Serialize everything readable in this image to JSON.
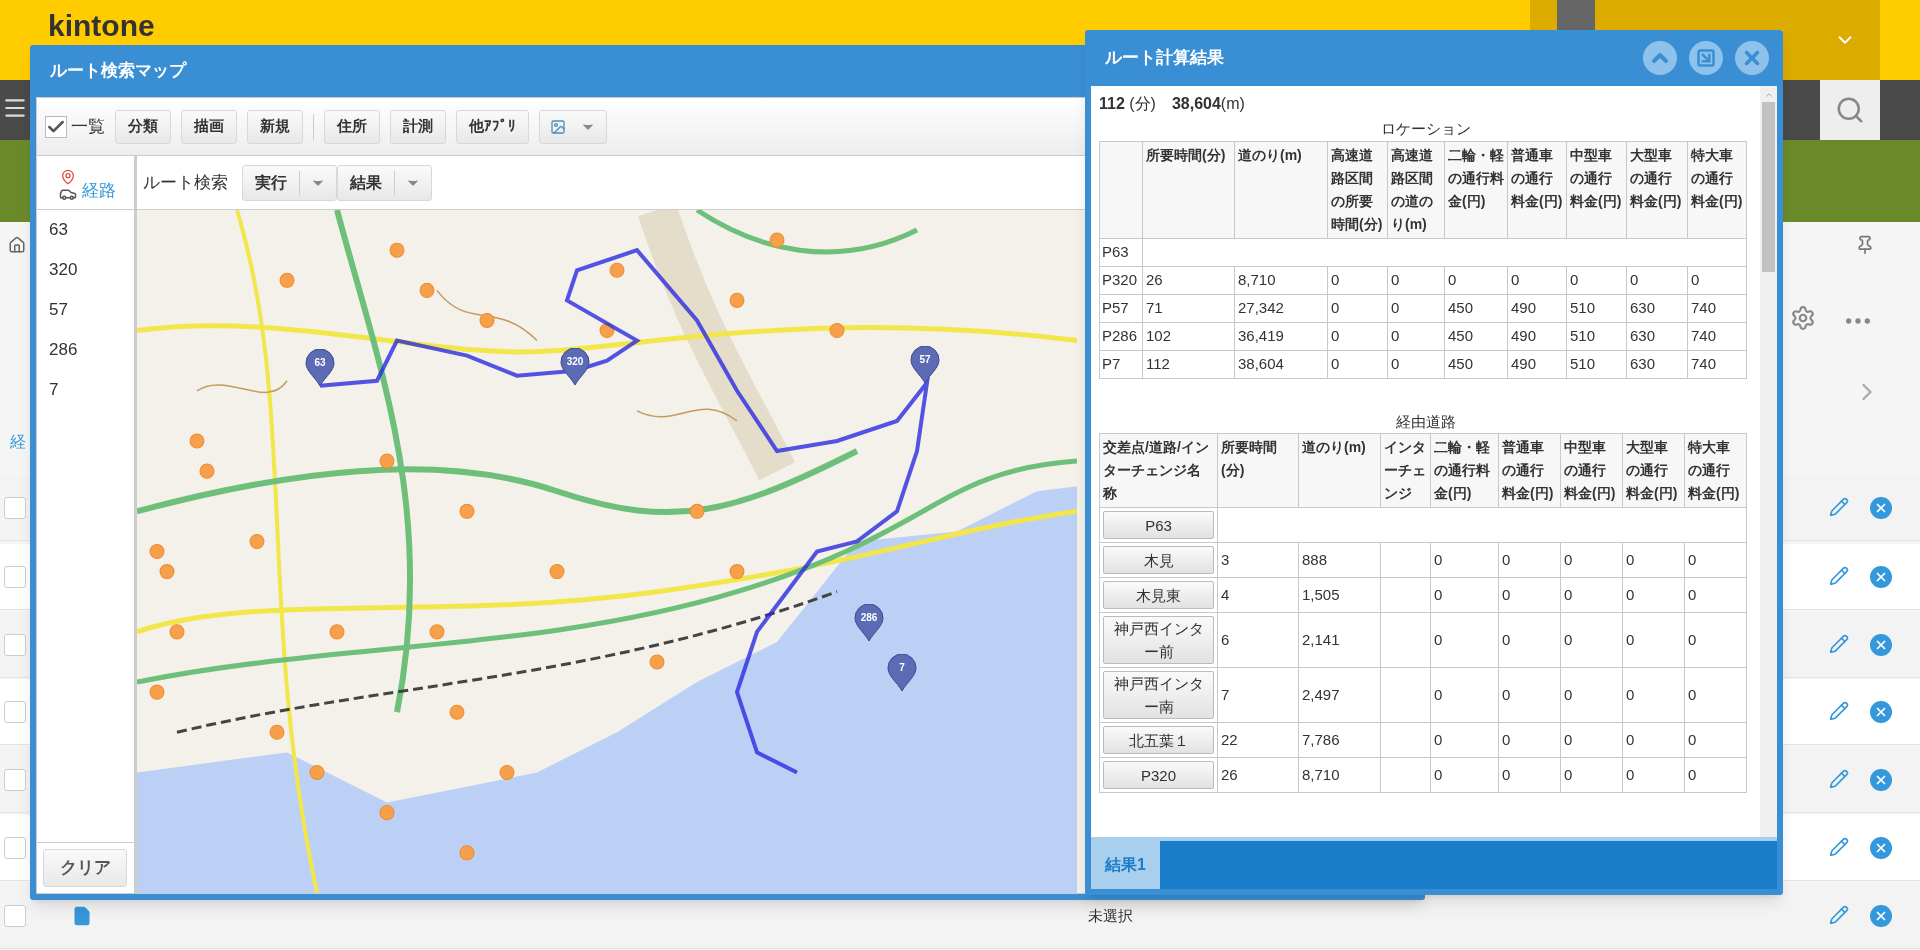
{
  "app": {
    "logo": "kintone",
    "column_label": "経"
  },
  "records": [
    {
      "checked": false
    },
    {
      "checked": false
    },
    {
      "checked": false
    },
    {
      "checked": false
    },
    {
      "checked": false
    },
    {
      "checked": false
    },
    {
      "checked": false,
      "status": "未選択"
    }
  ],
  "map_window": {
    "title": "ルート検索マップ",
    "list_toggle": {
      "label": "一覧",
      "checked": true
    },
    "toolbar_groups": [
      [
        "分類",
        "描画",
        "新規"
      ],
      [
        "住所",
        "計測",
        "他ｱﾌﾟﾘ"
      ]
    ],
    "side_tab": {
      "label": "経路",
      "selected": true
    },
    "route_search": {
      "label": "ルート検索",
      "buttons": [
        "実行",
        "結果"
      ]
    },
    "route_points": [
      "63",
      "320",
      "57",
      "286",
      "7"
    ],
    "clear_button": "クリア",
    "map": {
      "markers": [
        {
          "label": "63"
        },
        {
          "label": "320"
        },
        {
          "label": "57"
        },
        {
          "label": "286"
        },
        {
          "label": "7"
        }
      ]
    }
  },
  "result_window": {
    "title": "ルート計算結果",
    "summary": [
      "**112** (分)",
      "**38,604**(m)"
    ],
    "locations": {
      "caption": "ロケーション",
      "columns": [
        "所要時間(分)",
        "道のり(m)",
        "高速道路区間の所要時間(分)",
        "高速道路区間の道のり(m)",
        "二輪・軽の通行料金(円)",
        "普通車の通行料金(円)",
        "中型車の通行料金(円)",
        "大型車の通行料金(円)",
        "特大車の通行料金(円)"
      ],
      "rows": [
        {
          "point": "P63"
        },
        {
          "point": "P320",
          "time": "26",
          "distance": "8,710",
          "highway_time": "0",
          "highway_distance": "0",
          "tolls": [
            "0",
            "0",
            "0",
            "0",
            "0"
          ]
        },
        {
          "point": "P57",
          "time": "71",
          "distance": "27,342",
          "highway_time": "0",
          "highway_distance": "0",
          "tolls": [
            "450",
            "490",
            "510",
            "630",
            "740"
          ]
        },
        {
          "point": "P286",
          "time": "102",
          "distance": "36,419",
          "highway_time": "0",
          "highway_distance": "0",
          "tolls": [
            "450",
            "490",
            "510",
            "630",
            "740"
          ]
        },
        {
          "point": "P7",
          "time": "112",
          "distance": "38,604",
          "highway_time": "0",
          "highway_distance": "0",
          "tolls": [
            "450",
            "490",
            "510",
            "630",
            "740"
          ]
        }
      ]
    },
    "via_roads": {
      "caption": "経由道路",
      "columns": [
        "交差点/道路/インターチェンジ名称",
        "所要時間(分)",
        "道のり(m)",
        "インターチェンジ",
        "二輪・軽の通行料金(円)",
        "普通車の通行料金(円)",
        "中型車の通行料金(円)",
        "大型車の通行料金(円)",
        "特大車の通行料金(円)"
      ],
      "rows": [
        {
          "name": "P63"
        },
        {
          "name": "木見",
          "time": "3",
          "distance": "888",
          "tolls": [
            "0",
            "0",
            "0",
            "0",
            "0"
          ]
        },
        {
          "name": "木見東",
          "time": "4",
          "distance": "1,505",
          "tolls": [
            "0",
            "0",
            "0",
            "0",
            "0"
          ]
        },
        {
          "name": "神戸西インター前",
          "time": "6",
          "distance": "2,141",
          "tolls": [
            "0",
            "0",
            "0",
            "0",
            "0"
          ]
        },
        {
          "name": "神戸西インター南",
          "time": "7",
          "distance": "2,497",
          "tolls": [
            "0",
            "0",
            "0",
            "0",
            "0"
          ]
        },
        {
          "name": "北五葉１",
          "time": "22",
          "distance": "7,786",
          "tolls": [
            "0",
            "0",
            "0",
            "0",
            "0"
          ]
        },
        {
          "name": "P320",
          "time": "26",
          "distance": "8,710",
          "tolls": [
            "0",
            "0",
            "0",
            "0",
            "0"
          ]
        }
      ]
    },
    "tabs": [
      {
        "label": "結果1",
        "selected": true
      }
    ]
  }
}
